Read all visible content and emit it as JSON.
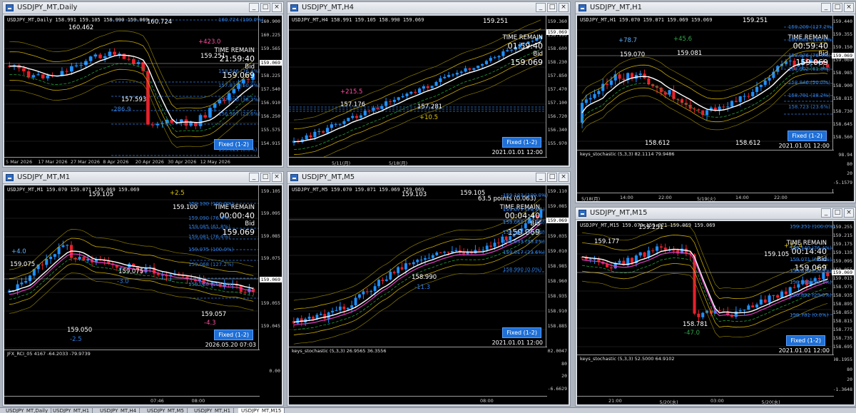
{
  "windows": {
    "w1": {
      "title": "USDJPY_MT,Daily",
      "symbol_line": "USDJPY_MT,Daily  158.991 159.105 158.990 159.069",
      "timer_label": "TIME REMAIN",
      "timer_value": "21:59:40",
      "bid_label": "Bid",
      "bid_value": "159.069",
      "fixed_button": "Fixed (1-2)",
      "price_ticks": [
        "160.900",
        "160.225",
        "159.565",
        "158.895",
        "158.225",
        "157.540",
        "156.910",
        "156.250",
        "155.575",
        "154.915"
      ],
      "current_price": "159.069",
      "time_ticks": [
        "5 Mar 2026",
        "17 Mar 2026",
        "27 Mar 2026",
        "8 Apr 2026",
        "20 Apr 2026",
        "30 Apr 2026",
        "12 May 2026"
      ],
      "labels": [
        "160.462",
        "160.724",
        "+423.0",
        "159.251",
        "157.593",
        "-286.9"
      ],
      "fib_labels": [
        "160.724 (100.0%)",
        "158.546 (76.4%)",
        "157.873 (50.0%)",
        "157.200 (38.2%)",
        "156.367 (23.6%)",
        "155.021 (0.0%)"
      ]
    },
    "w2": {
      "title": "USDJPY_MT,H4",
      "symbol_line": "USDJPY_MT,H4  158.991 159.105 158.990 159.069",
      "timer_label": "TIME REMAIN",
      "timer_value": "01:59:40",
      "bid_label": "Bid",
      "bid_value": "159.069",
      "fixed_button": "Fixed (1-2)",
      "stamp": "2021.01.01 12:00",
      "price_ticks": [
        "159.360",
        "158.990",
        "158.600",
        "158.230",
        "157.850",
        "157.470",
        "157.100",
        "156.720",
        "156.340",
        "155.970"
      ],
      "current_price": "159.069",
      "time_ticks": [
        "5/11(月)",
        "5/18(月)"
      ],
      "labels": [
        "159.251",
        "+215.5",
        "157.176",
        "157.281",
        "+10.5"
      ]
    },
    "w3": {
      "title": "USDJPY_MT,H1",
      "symbol_line": "USDJPY_MT,H1  159.070 159.071 159.069 159.069",
      "timer_label": "TIME REMAIN",
      "timer_value": "00:59:40",
      "bid_label": "Bid",
      "bid_value": "159.069",
      "fixed_button": "Fixed (1-2)",
      "stamp": "2021.01.01 12:00",
      "price_ticks": [
        "159.440",
        "159.355",
        "159.150",
        "159.069",
        "158.985",
        "158.900",
        "158.815",
        "158.730",
        "158.645",
        "158.560"
      ],
      "current_price": "159.069",
      "time_ticks": [
        "5/18(月)",
        "14:00",
        "22:00",
        "5/19(火)",
        "14:00",
        "22:00"
      ],
      "labels": [
        "159.251",
        "+78.7",
        "+45.6",
        "159.070",
        "159.081",
        "158.612",
        "158.612"
      ],
      "fib_labels": [
        "159.209 (127.2%)",
        "159.081 (100.0%)",
        "158.976 (76.4%)",
        "158.902 (61.8%)",
        "158.846 (50.0%)",
        "158.791 (38.2%)",
        "158.723 (23.6%)"
      ],
      "sub_label": "keys_stochastic (5,3,3) 82.1114 79.9486",
      "sub_ticks": [
        "98.94",
        "80",
        "20",
        "-5.1579"
      ]
    },
    "w4": {
      "title": "USDJPY_MT,M1",
      "symbol_line": "USDJPY_MT,M1  159.070 159.071 159.069 159.069",
      "timer_label": "TIME REMAIN",
      "timer_value": "00:00:40",
      "bid_label": "Bid",
      "bid_value": "159.069",
      "fixed_button": "Fixed (1-2)",
      "stamp": "2026.05.20 07:03",
      "price_ticks": [
        "159.105",
        "159.095",
        "159.085",
        "159.075",
        "159.065",
        "159.055",
        "159.045"
      ],
      "current_price": "159.069",
      "time_ticks": [
        "07:46",
        "08:00"
      ],
      "labels": [
        "159.105",
        "+2.5",
        "159.100",
        "+4.0",
        "159.075",
        "159.075",
        "-3.0",
        "159.057",
        "-4.3",
        "159.050",
        "-2.5"
      ],
      "fib_labels": [
        "159.100 (100.0%)",
        "159.090 (76.4%)",
        "159.085 (61.8%)",
        "159.081 (76.4%)",
        "159.075 (100.0%)",
        "159.068 (127.2%)",
        "159.060 (161.8%)"
      ],
      "sub_label": "JFX_RCI_05 4167 -64.2033 -79.9739",
      "sub_ticks": [
        "0.00"
      ]
    },
    "w5": {
      "title": "USDJPY_MT,M5",
      "symbol_line": "USDJPY_MT,M5  159.070 159.071 159.069 159.069",
      "timer_label": "TIME REMAIN",
      "timer_value": "00:04:40",
      "bid_label": "Bid",
      "bid_value": "159.069",
      "fixed_button": "Fixed (1-2)",
      "stamp": "2021.01.01 12:00",
      "price_ticks": [
        "159.110",
        "159.085",
        "159.060",
        "159.035",
        "159.010",
        "158.985",
        "158.960",
        "158.935",
        "158.910",
        "158.885"
      ],
      "current_price": "159.069",
      "time_ticks": [
        "08:00"
      ],
      "labels": [
        "159.103",
        "159.105",
        "63.5 points (0.063)",
        "158.990",
        "-11.3"
      ],
      "fib_labels": [
        "159.103 (100.0%)",
        "159.077 (76.4%)",
        "159.060 (61.8%)",
        "159.046 (50.0%)",
        "159.033 (38.2%)",
        "159.017 (23.6%)",
        "158.990 (0.0%)"
      ],
      "sub_label": "keys_stochastic (5,3,3) 26.9565 36.3556",
      "sub_ticks": [
        "102.0047",
        "80",
        "20",
        "-6.6629"
      ]
    },
    "w6": {
      "title": "USDJPY_MT,M15",
      "symbol_line": "USDJPY_MT,M15  159.070 159.071 159.069 159.069",
      "timer_label": "TIME REMAIN",
      "timer_value": "00:14:40",
      "bid_label": "Bid",
      "bid_value": "159.069",
      "fixed_button": "Fixed (1-2)",
      "stamp": "2021.01.01 12:00",
      "price_ticks": [
        "159.255",
        "159.215",
        "159.175",
        "159.135",
        "159.095",
        "159.055",
        "159.015",
        "158.975",
        "158.935",
        "158.895",
        "158.855",
        "158.815",
        "158.775",
        "158.735",
        "158.695"
      ],
      "current_price": "159.069",
      "time_ticks": [
        "21:00",
        "5/20(水)",
        "03:00",
        "5/20(水)"
      ],
      "labels": [
        "159.177",
        "159.251",
        "+32.4",
        "159.105",
        "158.781",
        "-47.0"
      ],
      "fib_labels": [
        "159.251 (100.0%)",
        "159.140 (76.4%)",
        "159.071 (61.8%)",
        "159.016 (50.0%)",
        "158.961 (38.2%)",
        "158.892 (23.6%)",
        "158.781 (0.0%)"
      ],
      "sub_label": "keys_stochastic (5,3,3) 52.5000 64.9102",
      "sub_ticks": [
        "98.1955",
        "80",
        "20",
        "-1.3648"
      ]
    }
  },
  "tabs": [
    "USDJPY_MT,Daily",
    "USDJPY_MT,H1",
    "USDJPY_MT,H4",
    "USDJPY_MT,M5",
    "USDJPY_MT,H1",
    "USDJPY_MT,M15"
  ],
  "colors": {
    "bull": "#1e90ff",
    "bear": "#e8202a",
    "ma": "#ffffff",
    "band": "#c8a800",
    "fib": "#2f7de0",
    "green": "#22a33a"
  },
  "window_buttons": {
    "minimize": "_",
    "maximize": "□",
    "close": "×"
  }
}
